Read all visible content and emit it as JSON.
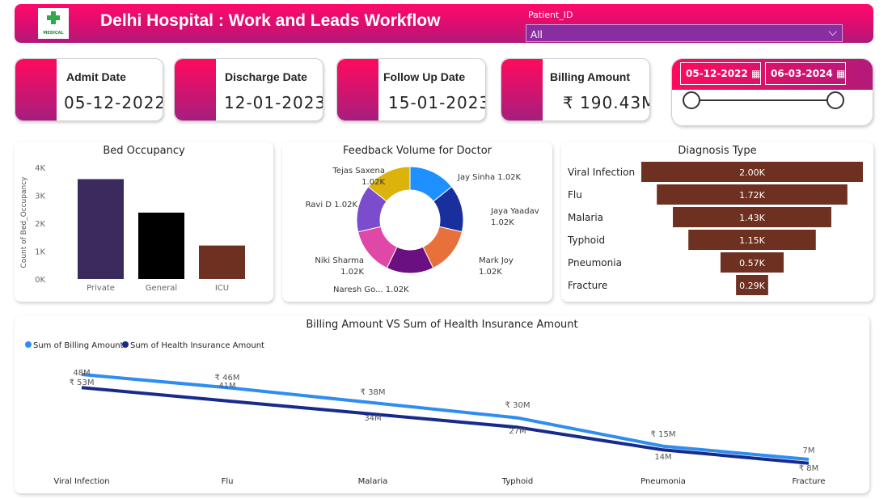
{
  "header": {
    "logo_text": "MEDICAL",
    "title": "Delhi Hospital : Work and Leads Workflow",
    "slicer_label": "Patient_ID",
    "slicer_value": "All"
  },
  "kpis": [
    {
      "label": "Admit Date",
      "value": "05-12-2022"
    },
    {
      "label": "Discharge Date",
      "value": "12-01-2023"
    },
    {
      "label": "Follow Up Date",
      "value": "15-01-2023"
    },
    {
      "label": "Billing Amount",
      "value": "₹ 190.43M"
    }
  ],
  "date_range": {
    "start": "05-12-2022",
    "end": "06-03-2024"
  },
  "colors": {
    "header_pink": "#ff0a6a",
    "header_purple": "#b01a7a",
    "funnel_brown": "#6e3020",
    "line_billing": "#2f8df0",
    "line_insurance": "#172b8c"
  },
  "bed_chart": {
    "title": "Bed Occupancy",
    "ylabel": "Count of Bed_Occupancy",
    "yticks": [
      "0K",
      "1K",
      "2K",
      "3K",
      "4K"
    ]
  },
  "donut": {
    "title": "Feedback Volume for Doctor"
  },
  "funnel": {
    "title": "Diagnosis Type"
  },
  "line": {
    "title": "Billing Amount VS Sum of Health Insurance Amount",
    "legend": [
      "Sum of Billing Amount",
      "Sum of Health Insurance Amount"
    ]
  },
  "chart_data": [
    {
      "type": "bar",
      "title": "Bed Occupancy",
      "ylabel": "Count of Bed_Occupancy",
      "ylim": [
        0,
        4000
      ],
      "categories": [
        "Private",
        "General",
        "ICU"
      ],
      "values": [
        3580,
        2380,
        1200
      ],
      "colors": [
        "#3a2a5e",
        "#000000",
        "#6e3020"
      ]
    },
    {
      "type": "pie",
      "title": "Feedback Volume for Doctor",
      "categories": [
        "Jay Sinha",
        "Jaya Yaadav",
        "Mark Joy",
        "Naresh Go...",
        "Niki Sharma",
        "Ravi D",
        "Tejas Saxena"
      ],
      "values": [
        1020,
        1020,
        1020,
        1020,
        1020,
        1020,
        1020
      ],
      "labels": [
        "1.02K",
        "1.02K",
        "1.02K",
        "1.02K",
        "1.02K",
        "1.02K",
        "1.02K"
      ],
      "colors": [
        "#1e90ff",
        "#1a2f9e",
        "#e8703a",
        "#6a1080",
        "#e048a8",
        "#7b4ccc",
        "#dbb30a"
      ]
    },
    {
      "type": "bar",
      "title": "Diagnosis Type",
      "categories": [
        "Viral Infection",
        "Flu",
        "Malaria",
        "Typhoid",
        "Pneumonia",
        "Fracture"
      ],
      "values": [
        2000,
        1720,
        1430,
        1150,
        570,
        290
      ],
      "labels": [
        "2.00K",
        "1.72K",
        "1.43K",
        "1.15K",
        "0.57K",
        "0.29K"
      ]
    },
    {
      "type": "line",
      "title": "Billing Amount VS Sum of Health Insurance Amount",
      "categories": [
        "Viral Infection",
        "Flu",
        "Malaria",
        "Typhoid",
        "Pneumonia",
        "Fracture"
      ],
      "series": [
        {
          "name": "Sum of Billing Amount",
          "values": [
            53,
            46,
            38,
            30,
            15,
            8
          ],
          "labels": [
            "₹ 53M",
            "₹ 46M",
            "₹ 38M",
            "₹ 30M",
            "₹ 15M",
            "₹ 8M"
          ]
        },
        {
          "name": "Sum of Health Insurance Amount",
          "values": [
            48,
            41,
            34,
            27,
            14,
            7
          ],
          "labels": [
            "48M",
            "41M",
            "34M",
            "27M",
            "14M",
            "7M"
          ]
        }
      ]
    }
  ]
}
